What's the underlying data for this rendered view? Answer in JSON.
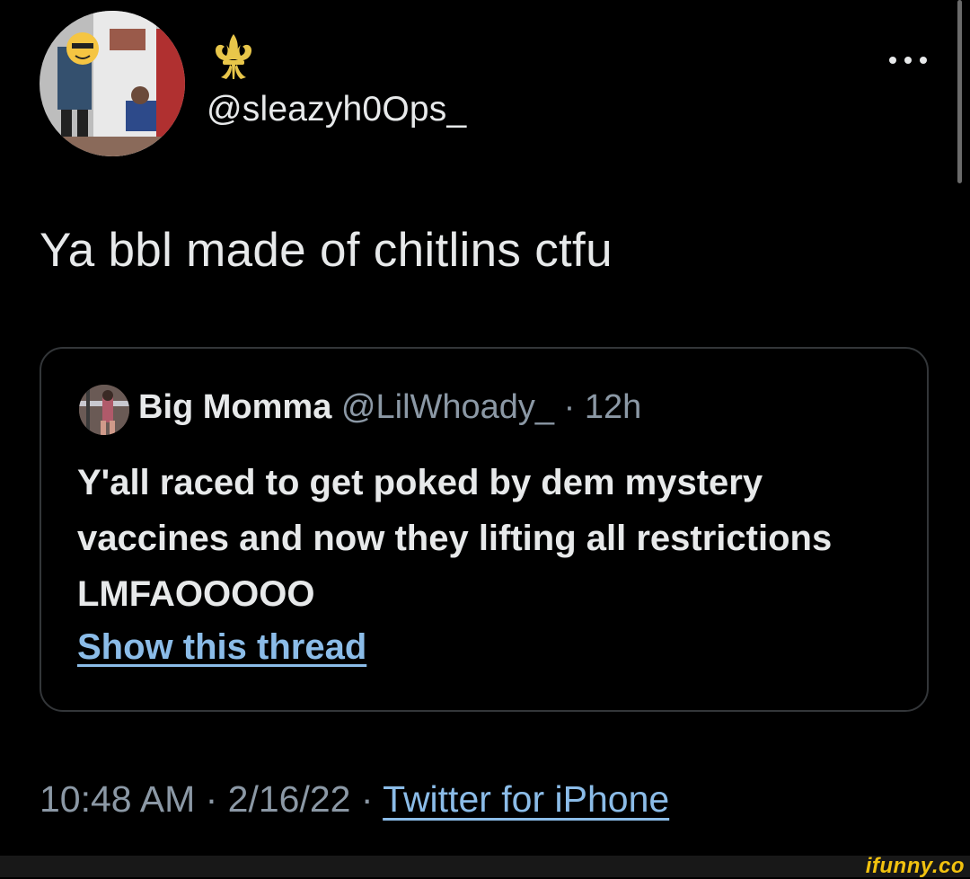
{
  "tweet": {
    "handle": "@sleazyh0Ops_",
    "text": "Ya bbl made of chitlins ctfu",
    "timestamp": "10:48 AM · 2/16/22 · ",
    "source": "Twitter for iPhone",
    "more_icon": "more-horizontal-icon",
    "badge_icon": "fleur-de-lis-icon"
  },
  "quote": {
    "name": "Big Momma",
    "meta": " @LilWhoady_ · 12h",
    "text": "Y'all raced to get poked by dem mystery vaccines and now they lifting all restrictions LMFAOOOOO",
    "show_thread": "Show this thread"
  },
  "watermark": "ifunny.co",
  "colors": {
    "background": "#000000",
    "text": "#e7e9ea",
    "muted": "#8b98a5",
    "link": "#8bbce8",
    "border": "#333639",
    "fleur": "#e8c64a",
    "watermark": "#f2c20f"
  }
}
